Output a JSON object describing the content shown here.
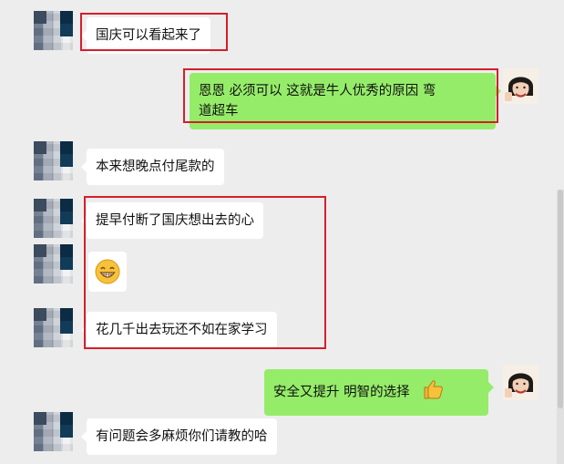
{
  "messages": [
    {
      "side": "left",
      "text": "国庆可以看起来了"
    },
    {
      "side": "right",
      "text_line1": "恩恩 必须可以 这就是牛人优秀的原因   弯",
      "text_line2": "道超车"
    },
    {
      "side": "left",
      "text": "本来想晚点付尾款的"
    },
    {
      "side": "left",
      "text": "提早付断了国庆想出去的心"
    },
    {
      "side": "left",
      "emoji": "grinning-face"
    },
    {
      "side": "left",
      "text": "花几千出去玩还不如在家学习"
    },
    {
      "side": "right",
      "text": "安全又提升   明智的选择",
      "emoji": "thumbs-up"
    },
    {
      "side": "left",
      "text": "有问题会多麻烦你们请教的哈"
    }
  ],
  "colors": {
    "background": "#ededed",
    "left_bubble": "#ffffff",
    "right_bubble": "#95ec69",
    "highlight_box": "#d41f2a"
  }
}
